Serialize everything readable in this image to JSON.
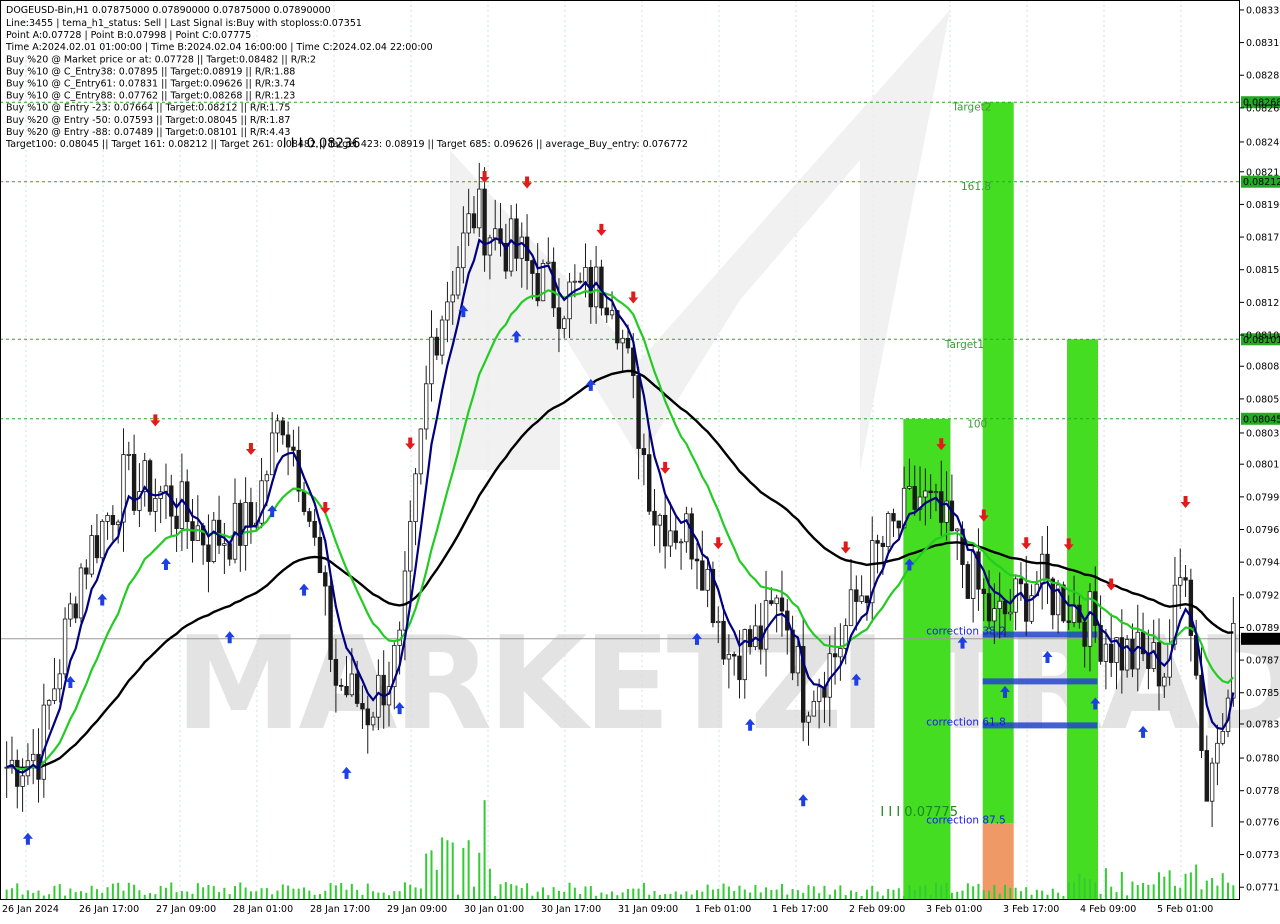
{
  "chart_data": {
    "type": "candlestick",
    "symbol_line": "DOGEUSD-Bin,H1  0.07875000 0.07890000 0.07875000 0.07890000",
    "info_lines": [
      "Line:3455 | tema_h1_status: Sell | Last Signal is:Buy with stoploss:0.07351",
      "Point A:0.07728 | Point B:0.07998 | Point C:0.07775",
      "Time A:2024.02.01 01:00:00 | Time B:2024.02.04 16:00:00 | Time C:2024.02.04 22:00:00",
      "Buy %20 @ Market price or at: 0.07728 || Target:0.08482 || R/R:2",
      "Buy %10 @ C_Entry38: 0.07895 || Target:0.08919 || R/R:1.88",
      "Buy %10 @ C_Entry61: 0.07831 || Target:0.09626 || R/R:3.74",
      "Buy %10 @ C_Entry88: 0.07762 || Target:0.08268 || R/R:1.23",
      "Buy %10 @ Entry -23: 0.07664 || Target:0.08212 || R/R:1.75",
      "Buy %20 @ Entry -50: 0.07593 || Target:0.08045 || R/R:1.87",
      "Buy %20 @ Entry -88: 0.07489 || Target:0.08101 || R/R:4.43",
      "Target100: 0.08045 || Target 161: 0.08212 || Target 261: 0.08482 || Target 423: 0.08919 || Target 685: 0.09626 || average_Buy_entry: 0.076772"
    ],
    "y_ticks": [
      "0.08333",
      "0.08310",
      "0.08287",
      "0.08264",
      "0.08240",
      "0.08219",
      "0.08196",
      "0.08173",
      "0.08150",
      "0.08127",
      "0.08104",
      "0.08082",
      "0.08059",
      "0.08035",
      "0.08013",
      "0.07990",
      "0.07967",
      "0.07944",
      "0.07921",
      "0.07898",
      "0.07875",
      "0.07852",
      "0.07830",
      "0.07806",
      "0.07783",
      "0.07761",
      "0.07738",
      "0.07715"
    ],
    "ylim": [
      0.07706,
      0.0834
    ],
    "x_ticks": [
      "26 Jan 2024",
      "26 Jan 17:00",
      "27 Jan 09:00",
      "28 Jan 01:00",
      "28 Jan 17:00",
      "29 Jan 09:00",
      "30 Jan 01:00",
      "30 Jan 17:00",
      "31 Jan 09:00",
      "1 Feb 01:00",
      "1 Feb 17:00",
      "2 Feb 09:00",
      "3 Feb 01:00",
      "3 Feb 17:00",
      "4 Feb 09:00",
      "5 Feb 01:00"
    ],
    "current_price": "0.07890",
    "level_lines": [
      {
        "value": 0.08268,
        "label": "0.08268",
        "color": "#22aa22"
      },
      {
        "value": 0.08212,
        "label": "0.08212",
        "color": "#22aa22"
      },
      {
        "value": 0.08101,
        "label": "0.08101",
        "color": "#22aa22"
      },
      {
        "value": 0.08045,
        "label": "0.08045",
        "color": "#22aa22"
      }
    ],
    "annotations": [
      {
        "text": "I I I 0.08236",
        "x_frac": 0.228,
        "price": 0.08236,
        "color": "#000000"
      },
      {
        "text": "I I I 0.07775",
        "x_frac": 0.71,
        "price": 0.07765,
        "color": "#1a8a1a"
      },
      {
        "text": "Target2",
        "x_frac": 0.768,
        "price": 0.08262,
        "color": "#3a9a3a"
      },
      {
        "text": "161.8",
        "x_frac": 0.775,
        "price": 0.08206,
        "color": "#3a9a3a"
      },
      {
        "text": "Target1",
        "x_frac": 0.762,
        "price": 0.08095,
        "color": "#3a9a3a"
      },
      {
        "text": "100",
        "x_frac": 0.78,
        "price": 0.08039,
        "color": "#3a9a3a"
      },
      {
        "text": "correction 38.2",
        "x_frac": 0.747,
        "price": 0.07893,
        "color": "#1a1aee"
      },
      {
        "text": "correction 61.8",
        "x_frac": 0.747,
        "price": 0.07829,
        "color": "#1a1aee"
      },
      {
        "text": "correction 87.5",
        "x_frac": 0.747,
        "price": 0.0776,
        "color": "#1a1aee"
      }
    ],
    "watermark": "MARKETZI TRADE",
    "colors": {
      "ema_dark": "#000080",
      "ema_green": "#22cc22",
      "ema_black": "#000000",
      "target_bar": "#44dd22",
      "entry_bar": "#44dd22",
      "stop_box": "#ee9966",
      "arrow_up": "#1f3fe6",
      "arrow_down": "#e21a1a",
      "level_line": "#22aa22",
      "candle": "#1a1a1a",
      "volume": "#33cc33"
    }
  }
}
